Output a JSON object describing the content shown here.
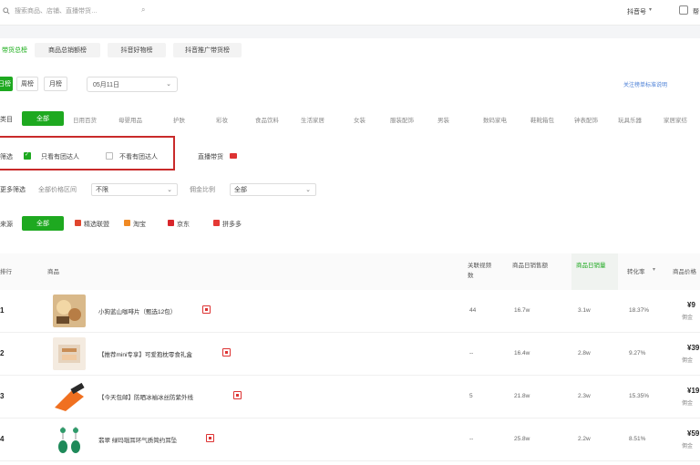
{
  "search": {
    "placeholder": "搜索商品、店铺、直播带货…"
  },
  "topbar": {
    "user_label": "抖音号",
    "right_label": "帮"
  },
  "tabs": [
    {
      "label": "带货总榜"
    },
    {
      "label": "商品总销额榜"
    },
    {
      "label": "抖音好物榜"
    },
    {
      "label": "抖音推广带货榜"
    }
  ],
  "period": {
    "buttons": [
      "日榜",
      "周榜",
      "月榜"
    ],
    "selected_date": "05月11日",
    "link": "关注榜单标准说明"
  },
  "category": {
    "label": "类目",
    "all_label": "全部",
    "items": [
      "日用百货",
      "母婴用品",
      "护肤",
      "彩妆",
      "食品饮料",
      "生活家居",
      "女装",
      "服装配饰",
      "男装",
      "数码家电",
      "鞋靴箱包",
      "钟表配饰",
      "玩具乐器",
      "家居家纺"
    ]
  },
  "filter": {
    "label": "筛选",
    "opt1": "只看有团达人",
    "opt2": "不看有团达人",
    "live_label": "直播带货"
  },
  "extra_filter": {
    "label": "更多筛选",
    "price_label": "全部价格区间",
    "price_value": "不限",
    "commission_label": "佣金比例",
    "commission_value": "全部"
  },
  "source": {
    "label": "来源",
    "all_label": "全部",
    "items": [
      "精选联盟",
      "淘宝",
      "京东",
      "拼多多"
    ]
  },
  "table": {
    "headers": {
      "rank": "排行",
      "product": "商品",
      "col1": "关联视频数",
      "col2": "商品日销售额",
      "col3": "商品日销量",
      "col4": "转化率",
      "col5": "商品价格"
    },
    "rows": [
      {
        "rank": "1",
        "name": "小狗蓝山咖啡片（甄选12包）",
        "c1": "44",
        "c2": "16.7w",
        "c3": "3.1w",
        "c4": "18.37%",
        "price": "¥9",
        "sub": "佣金"
      },
      {
        "rank": "2",
        "name": "【推荐mini专享】可爱抱枕零食礼盒",
        "c1": "--",
        "c2": "16.4w",
        "c3": "2.8w",
        "c4": "9.27%",
        "price": "¥39",
        "sub": "佣金"
      },
      {
        "rank": "3",
        "name": "【今天包邮】防晒冰袖冰丝防紫外线",
        "c1": "5",
        "c2": "21.8w",
        "c3": "2.3w",
        "c4": "15.35%",
        "price": "¥19",
        "sub": "佣金"
      },
      {
        "rank": "4",
        "name": "翡翠 绿玛瑙耳环气质简约耳坠",
        "c1": "--",
        "c2": "25.8w",
        "c3": "2.2w",
        "c4": "8.51%",
        "price": "¥59",
        "sub": "佣金"
      }
    ]
  },
  "colors": {
    "accent": "#1ea920",
    "highlight_box": "#c92a2a",
    "link": "#4a7fd6"
  }
}
